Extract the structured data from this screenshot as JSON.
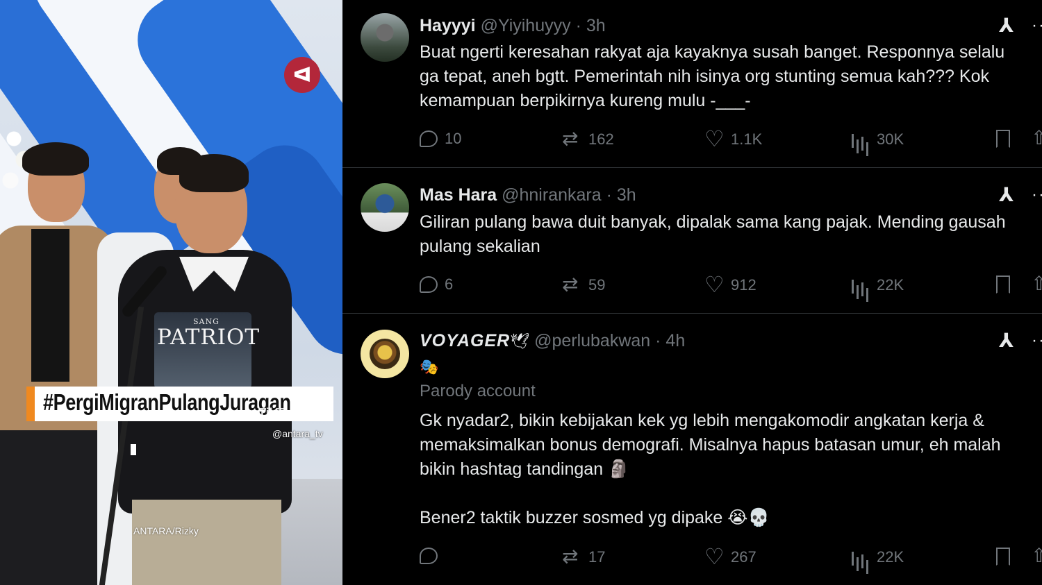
{
  "photo": {
    "hashtag": "#PergiMigranPulangJuragan",
    "shirt_small": "SANG",
    "shirt_big": "PATRIOT",
    "watermark": "TikTok",
    "watermark_handle": "@antara_tv",
    "credit": "ANTARA/Rizky"
  },
  "tweets": [
    {
      "name": "Hayyyi",
      "handle": "@Yiyihuyyy · 3h",
      "text": "Buat ngerti keresahan rakyat aja kayaknya susah banget. Responnya selalu\nga tepat, aneh bgtt. Pemerintah nih isinya org stunting semua kah??? Kok\nkemampuan berpikirnya kureng mulu -___-",
      "replies": "10",
      "reposts": "162",
      "likes": "1.1K",
      "views": "30K"
    },
    {
      "name": "Mas Hara",
      "handle": "@hnirankara · 3h",
      "text": "Giliran pulang bawa duit banyak, dipalak sama kang pajak. Mending gausah\npulang sekalian",
      "replies": "6",
      "reposts": "59",
      "likes": "912",
      "views": "22K"
    },
    {
      "name": "VOYAGER",
      "name_emoji": "🕊",
      "handle": "@perlubakwan · 4h",
      "bio_emoji": "🎭",
      "label": "Parody account",
      "text": "Gk nyadar2, bikin kebijakan kek yg lebih mengakomodir angkatan kerja &\nmemaksimalkan bonus demografi. Misalnya hapus batasan umur, eh malah\nbikin hashtag tandingan 🗿\n\nBener2 taktik buzzer sosmed yg dipake 😭💀",
      "replies": "",
      "reposts": "17",
      "likes": "267",
      "views": "22K"
    }
  ],
  "icons": {
    "grok": "grok-icon",
    "more": "more-icon",
    "reply": "reply-icon",
    "repost": "repost-icon",
    "like": "like-icon",
    "views": "views-icon",
    "bookmark": "bookmark-icon",
    "share": "share-icon"
  },
  "colors": {
    "background": "#000000",
    "text": "#e7e9ea",
    "muted": "#71767b",
    "divider": "#2f3336",
    "hashtag_accent": "#f0891f"
  }
}
